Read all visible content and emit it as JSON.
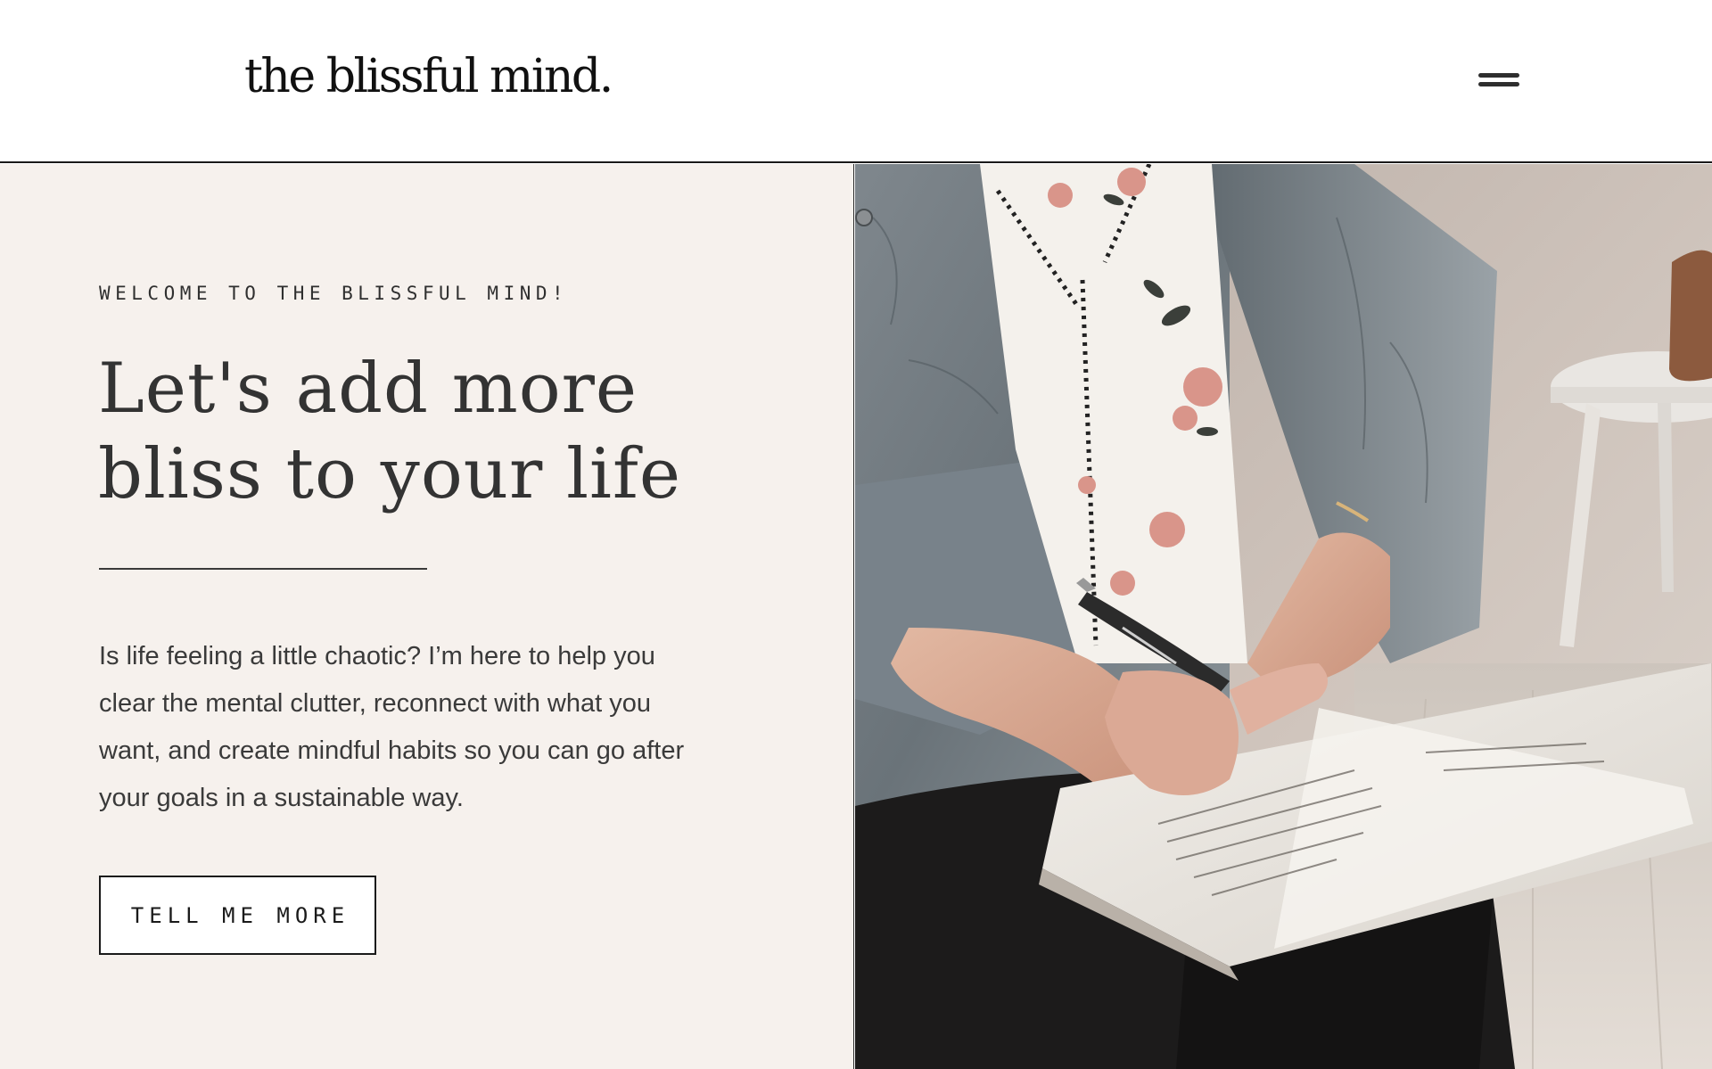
{
  "header": {
    "logo_text": "the blissful mind.",
    "menu_icon": "hamburger-menu-icon"
  },
  "hero": {
    "eyebrow": "WELCOME TO THE BLISSFUL MIND!",
    "headline_lines": [
      "Let's add more",
      "bliss to your life"
    ],
    "body_lines": [
      "Is life feeling a little chaotic? I’m here to help you",
      "clear the mental clutter, reconnect with what you",
      "want, and create mindful habits so you can go after",
      "your goals in a sustainable way."
    ],
    "cta_label": "TELL ME MORE"
  },
  "colors": {
    "hero_background": "#f6f1ed",
    "header_background": "#ffffff",
    "text_primary": "#333333",
    "accent_dark": "#1a1a1a"
  }
}
